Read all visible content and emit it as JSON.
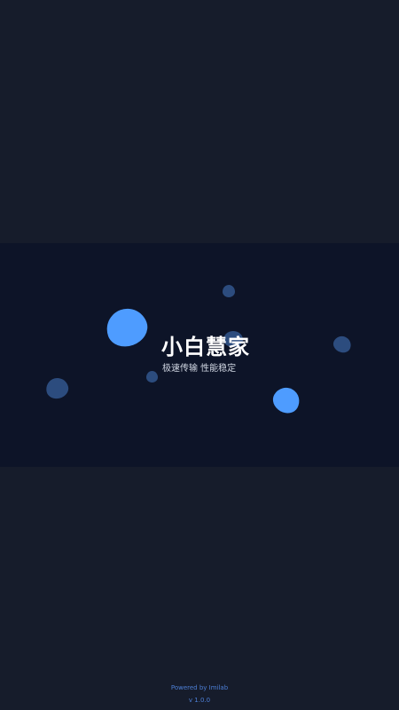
{
  "app": {
    "title": "小白慧家",
    "tagline": "极速传输  性能稳定"
  },
  "footer": {
    "powered_by": "Powered by Imilab",
    "version": "v 1.0.0"
  },
  "colors": {
    "background": "#161c2b",
    "band": "#0d1428",
    "accent": "#4e9cff",
    "accent_dim": "#2c4c7e",
    "footer_text": "#4d7fd6"
  }
}
